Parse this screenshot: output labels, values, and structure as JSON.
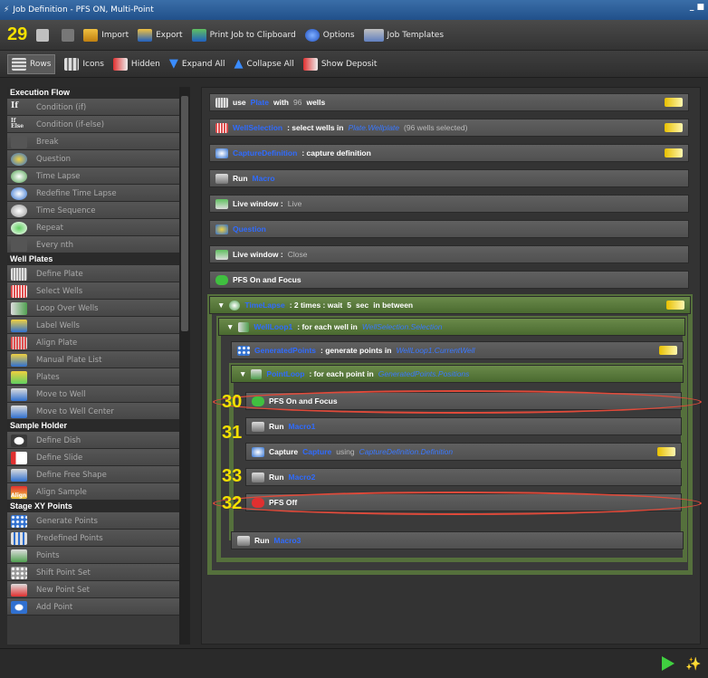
{
  "window": {
    "title": "Job Definition - PFS ON, Multi-Point"
  },
  "toolbar1": {
    "counter": "29",
    "import": "Import",
    "export": "Export",
    "print": "Print Job to Clipboard",
    "options": "Options",
    "templates": "Job Templates"
  },
  "toolbar2": {
    "rows": "Rows",
    "icons": "Icons",
    "hidden": "Hidden",
    "expand": "Expand All",
    "collapse": "Collapse All",
    "deposit": "Show Deposit"
  },
  "sidebar": {
    "execution_flow": "Execution Flow",
    "exec_items": [
      "Condition (if)",
      "Condition (if-else)",
      "Break",
      "Question",
      "Time Lapse",
      "Redefine Time Lapse",
      "Time Sequence",
      "Repeat",
      "Every nth"
    ],
    "exec_icon_text": [
      "If",
      "If Else"
    ],
    "well_plates": "Well Plates",
    "well_items": [
      "Define Plate",
      "Select Wells",
      "Loop Over Wells",
      "Label Wells",
      "Align Plate",
      "Manual Plate List",
      "Plates",
      "Move to Well",
      "Move to Well Center"
    ],
    "sample_holder": "Sample Holder",
    "sample_items": [
      "Define Dish",
      "Define Slide",
      "Define Free Shape",
      "Align Sample"
    ],
    "sample_icon_text": "Align",
    "stage_xy": "Stage XY Points",
    "stage_items": [
      "Generate Points",
      "Predefined Points",
      "Points",
      "Shift Point Set",
      "New Point Set",
      "Add Point"
    ]
  },
  "jobs": {
    "j1": {
      "kw": "use",
      "var": "Plate",
      "mid": "with",
      "num": "96",
      "end": "wells"
    },
    "j2": {
      "var": "WellSelection",
      "mid": ": select wells in",
      "ref": "Plate.Wellplate",
      "note": "(96 wells selected)"
    },
    "j3": {
      "var": "CaptureDefinition",
      "mid": ": capture definition"
    },
    "j4": {
      "kw": "Run",
      "var": "Macro"
    },
    "j5": {
      "kw": "Live window :",
      "val": "Live"
    },
    "j6": {
      "var": "Question"
    },
    "j7": {
      "kw": "Live window :",
      "val": "Close"
    },
    "j8": {
      "kw": "PFS On and Focus"
    },
    "g1": {
      "var": "TimeLapse",
      "a": ": 2 times : wait",
      "b": "5",
      "c": "sec",
      "d": "in between"
    },
    "g2": {
      "var": "WellLoop1",
      "mid": ": for each well in",
      "ref": "WellSelection.Selection"
    },
    "j9": {
      "var": "GeneratedPoints",
      "mid": ": generate points in",
      "ref": "WellLoop1.CurrentWell"
    },
    "g3": {
      "var": "PointLoop",
      "mid": ": for each point in",
      "ref": "GeneratedPoints.Positions"
    },
    "j10": {
      "kw": "PFS On and Focus"
    },
    "j11": {
      "kw": "Run",
      "var": "Macro1"
    },
    "j12": {
      "kw": "Capture",
      "var": "Capture",
      "mid": "using",
      "ref": "CaptureDefinition.Definition"
    },
    "j13": {
      "kw": "Run",
      "var": "Macro2"
    },
    "j14": {
      "kw": "PFS Off"
    },
    "j15": {
      "kw": "Run",
      "var": "Macro3"
    }
  },
  "steps": {
    "s30": "30",
    "s31": "31",
    "s33": "33",
    "s32": "32"
  }
}
